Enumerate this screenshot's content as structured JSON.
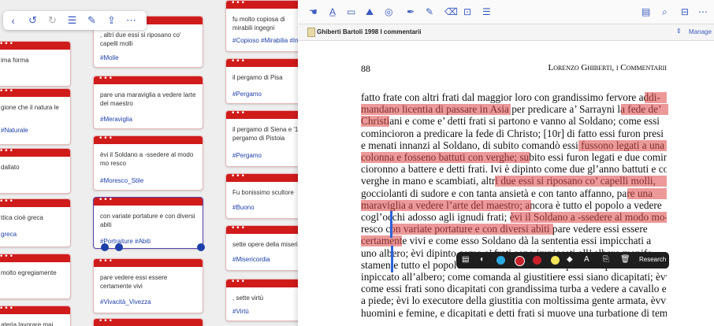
{
  "board": {
    "left_cards": [
      {
        "text": "ima forma",
        "tag": ""
      },
      {
        "text": "gione che il natura le",
        "tag": "#Naturale"
      },
      {
        "text": "dallato",
        "tag": ""
      },
      {
        "text": "ttica cioè greca",
        "tag": "greca"
      },
      {
        "text": "molto egregiamente",
        "tag": ""
      },
      {
        "text": "ateria lavorare mai",
        "tag": ""
      }
    ],
    "mid_cards": [
      {
        "text": ", altri due essi si riposano co' capelli molli",
        "tag": "#Molle"
      },
      {
        "text": "pare una maraviglia a vedere larte del maestro",
        "tag": "#Meraviglia"
      },
      {
        "text": "èvi il Soldano a -ssedere al modo mo resco",
        "tag": "#Moresco_Stile"
      },
      {
        "text": "con variate portature e con diversi abiti",
        "tag": "#Portraiture #Abiti"
      },
      {
        "text": "pare vedere essi essere certamente vivi",
        "tag": "#Vivacità_Vivezza"
      }
    ],
    "right_cards": [
      {
        "text": "fu molto copiosa di mirabili ingegni",
        "tag": "#Copioso #Mirabilia #Ingegno"
      },
      {
        "text": "il pergamo di Pisa",
        "tag": "#Pergamo"
      },
      {
        "text": "il pergamo di Siena e '1 pergamo di Pistoia",
        "tag": "#Pergamo"
      },
      {
        "text": "Fu bonissimo scultore",
        "tag": "#Buono"
      },
      {
        "text": "sette opere della misericordia",
        "tag": "#Misericordia"
      },
      {
        "text": ", sette virtù",
        "tag": "#Virtù"
      }
    ]
  },
  "toolbar": {
    "back": "‹",
    "undo": "↺",
    "redo": "↻",
    "list": "☰",
    "edit": "✎",
    "share": "⇪",
    "more": "⋯"
  },
  "reader": {
    "tab_title": "Ghiberti Bartoli 1998 I commentarii",
    "manage": "Manage",
    "page_number": "88",
    "running_head": "Lorenzo Ghiberti, i Commentarii",
    "research": "Research",
    "lines": [
      "fatto frate con altri frati dal maggior loro con grandissimo fervore addi-",
      "mandano licentia di passare in Asia per predicare a’ Sarrayni la fede de’",
      "Christiani e come e’ detti frati si partono e vanno al Soldano; come essi",
      "comincioron a predicare la fede di Christo; [10r] di fatto essi furon presi",
      "e menati innanzi al Soldano, di subito comandò essi fussono legati a una",
      "colonna e fosseno battuti con verghe; subito essi furon legati e due comin-",
      "cioronno a battere e detti frati. Ivi è dipinto come due gl’anno battuti e colle",
      "verghe in mano e scambiati, altri due essi si riposano co’ capelli molli,",
      "gocciolanti di sudore e con tanta ansietà e con tanto affanno, pare una",
      "maraviglia a vedere l’arte del maestro; ancora è tutto el popolo a vedere",
      "cogl’occhi adosso agli ignudi frati; èvi il Soldano a -ssedere al modo mo-",
      "resco con variate portature e con diversi abiti pare vedere essi essere",
      "certamente vivi e come esso Soldano dà la sententia essi impicchati a",
      "uno albero; èvi dipinto come e’ frati sono impiccati all’ albero manife-",
      "stamente tutto el popolo che v’è a vedere sentire parlare e predicare il frate",
      "inpiccato all’albero; come comanda al giustitiere essi siano dicapitati; èvvi",
      "come essi frati sono dicapitati con grandissima turba a vedere a cavallo e",
      "a piede; èvi lo executore della giustitia con moltissima gente armata, èvvi",
      "huomini e femine, e dicapitati e detti frati si muove una turbatione di tempo"
    ]
  },
  "colors": {
    "accent": "#d01b1b",
    "highlight": "#e98a8a",
    "tag": "#1d3fa8",
    "toolbar_icon": "#3a5bbf"
  }
}
